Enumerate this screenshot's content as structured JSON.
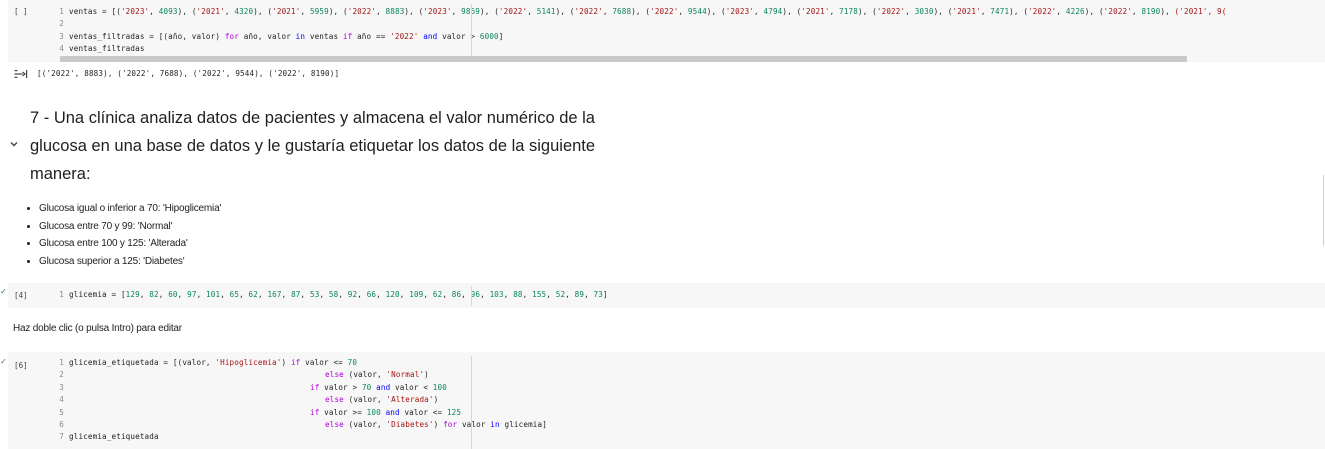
{
  "cell1": {
    "prompt": "[ ]",
    "line_numbers": [
      "1",
      "2",
      "3",
      "4"
    ],
    "line1": {
      "prefix": "ventas = [(",
      "items": [
        [
          "'2023'",
          "4093"
        ],
        [
          "'2021'",
          "4320"
        ],
        [
          "'2021'",
          "5959"
        ],
        [
          "'2022'",
          "8883"
        ],
        [
          "'2023'",
          "9859"
        ],
        [
          "'2022'",
          "5141"
        ],
        [
          "'2022'",
          "7688"
        ],
        [
          "'2022'",
          "9544"
        ],
        [
          "'2023'",
          "4794"
        ],
        [
          "'2021'",
          "7178"
        ],
        [
          "'2022'",
          "3030"
        ],
        [
          "'2021'",
          "7471"
        ],
        [
          "'2022'",
          "4226"
        ],
        [
          "'2022'",
          "8190"
        ]
      ],
      "tail": "('2021', 9("
    },
    "line3": {
      "p1": "ventas_filtradas = [(año, valor) ",
      "kw_for": "for",
      "p2": " año, valor ",
      "kw_in": "in",
      "p3": " ventas ",
      "kw_if": "if",
      "p4": " año == ",
      "str_2022": "'2022'",
      "kw_and": " and",
      "p5": " valor > ",
      "num_6000": "6000",
      "p6": "]"
    },
    "line4": "ventas_filtradas"
  },
  "output1": {
    "text": "[('2022', 8883), ('2022', 7688), ('2022', 9544), ('2022', 8190)]"
  },
  "markdown": {
    "heading": "7 - Una clínica analiza datos de pacientes y almacena el valor numérico de la glucosa en una base de datos y le gustaría etiquetar los datos de la siguiente manera:",
    "bullets": [
      "Glucosa igual o inferior a 70: 'Hipoglicemia'",
      "Glucosa entre 70 y 99: 'Normal'",
      "Glucosa entre 100 y 125: 'Alterada'",
      "Glucosa superior a 125: 'Diabetes'"
    ]
  },
  "cell2": {
    "prompt": "[4]",
    "line_number": "1",
    "prefix": "glicemia = [",
    "values": [
      "129",
      "82",
      "60",
      "97",
      "101",
      "65",
      "62",
      "167",
      "87",
      "53",
      "58",
      "92",
      "66",
      "120",
      "109",
      "62",
      "86",
      "96",
      "103",
      "88",
      "155",
      "52",
      "89",
      "73"
    ],
    "suffix": "]"
  },
  "edit_hint": "Haz doble clic (o pulsa Intro) para editar",
  "cell3": {
    "prompt": "[6]",
    "line_numbers": [
      "1",
      "2",
      "3",
      "4",
      "5",
      "6",
      "7"
    ],
    "l1": {
      "a": "glicemia_etiquetada = [(valor, ",
      "s": "'Hipoglicemia'",
      "b": ") ",
      "kif": "if",
      "c": " valor <= ",
      "n": "70"
    },
    "l2": {
      "kelse": "else",
      "a": " (valor, ",
      "s": "'Normal'",
      "b": ")"
    },
    "l3": {
      "kif": "if",
      "a": " valor > ",
      "n1": "70",
      "kand": " and",
      "b": " valor < ",
      "n2": "100"
    },
    "l4": {
      "kelse": "else",
      "a": " (valor, ",
      "s": "'Alterada'",
      "b": ")"
    },
    "l5": {
      "kif": "if",
      "a": " valor >= ",
      "n1": "100",
      "kand": " and",
      "b": " valor <= ",
      "n2": "125"
    },
    "l6": {
      "kelse": "else",
      "a": " (valor, ",
      "s": "'Diabetes'",
      "b": ") ",
      "kfor": "for",
      "c": " valor ",
      "kin": "in",
      "d": " glicemia]"
    },
    "l7": "glicemia_etiquetada"
  },
  "icons": {
    "output_icon": "output-toggle-icon",
    "chevron": "chevron-down-icon",
    "run_status": "run-status-icon"
  },
  "colors": {
    "string": "#a31515",
    "number": "#098658",
    "keyword": "#af00db",
    "keyword_blue": "#0000ff",
    "cell_bg": "#f7f7f7"
  }
}
